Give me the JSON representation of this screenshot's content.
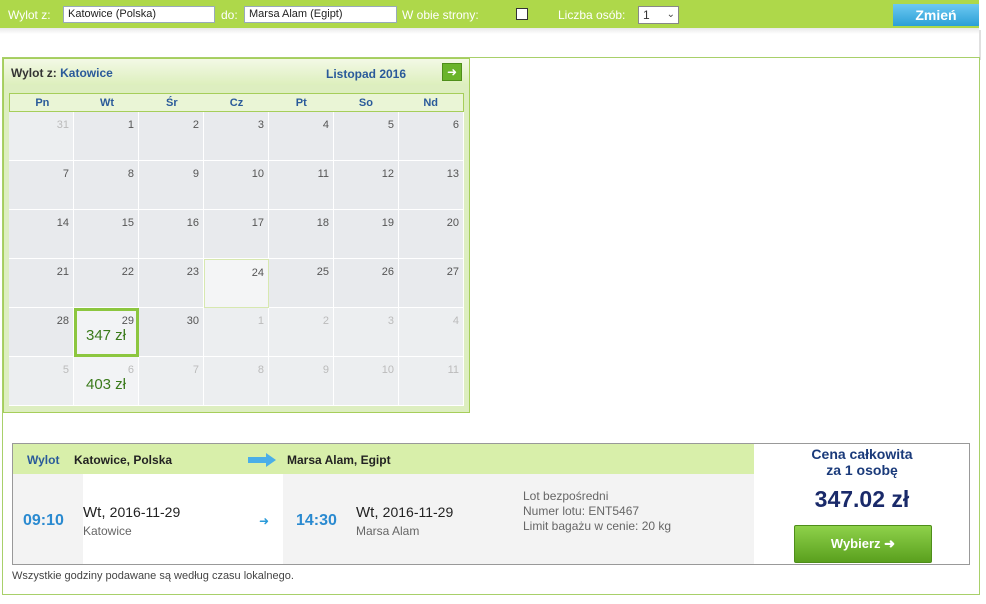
{
  "search": {
    "from_label": "Wylot z:",
    "from_value": "Katowice (Polska)",
    "to_label": "do:",
    "to_value": "Marsa Alam (Egipt)",
    "roundtrip_label": "W obie strony:",
    "passengers_label": "Liczba osób:",
    "passengers_value": "1",
    "change_button": "Zmień"
  },
  "calendar": {
    "from_prefix": "Wylot z:",
    "from_city": "Katowice",
    "month": "Listopad 2016",
    "weekdays": [
      "Pn",
      "Wt",
      "Śr",
      "Cz",
      "Pt",
      "So",
      "Nd"
    ],
    "days": [
      {
        "n": "31",
        "off": true
      },
      {
        "n": "1"
      },
      {
        "n": "2"
      },
      {
        "n": "3"
      },
      {
        "n": "4"
      },
      {
        "n": "5"
      },
      {
        "n": "6"
      },
      {
        "n": "7"
      },
      {
        "n": "8"
      },
      {
        "n": "9"
      },
      {
        "n": "10"
      },
      {
        "n": "11"
      },
      {
        "n": "12"
      },
      {
        "n": "13"
      },
      {
        "n": "14"
      },
      {
        "n": "15"
      },
      {
        "n": "16"
      },
      {
        "n": "17"
      },
      {
        "n": "18"
      },
      {
        "n": "19"
      },
      {
        "n": "20"
      },
      {
        "n": "21"
      },
      {
        "n": "22"
      },
      {
        "n": "23"
      },
      {
        "n": "24",
        "today": true
      },
      {
        "n": "25"
      },
      {
        "n": "26"
      },
      {
        "n": "27"
      },
      {
        "n": "28"
      },
      {
        "n": "29",
        "price": "347 zł",
        "selected": true
      },
      {
        "n": "30"
      },
      {
        "n": "1",
        "off": true
      },
      {
        "n": "2",
        "off": true
      },
      {
        "n": "3",
        "off": true
      },
      {
        "n": "4",
        "off": true
      },
      {
        "n": "5",
        "off": true
      },
      {
        "n": "6",
        "off": true,
        "price": "403 zł"
      },
      {
        "n": "7",
        "off": true
      },
      {
        "n": "8",
        "off": true
      },
      {
        "n": "9",
        "off": true
      },
      {
        "n": "10",
        "off": true
      },
      {
        "n": "11",
        "off": true
      }
    ]
  },
  "flight": {
    "header_label": "Wylot",
    "from_place": "Katowice, Polska",
    "to_place": "Marsa Alam, Egipt",
    "dep_time": "09:10",
    "dep_day": "Wt,",
    "dep_date": "2016-11-29",
    "dep_city": "Katowice",
    "arr_time": "14:30",
    "arr_day": "Wt,",
    "arr_date": "2016-11-29",
    "arr_city": "Marsa Alam",
    "detail_direct": "Lot bezpośredni",
    "detail_flight_no": "Numer lotu: ENT5467",
    "detail_baggage": "Limit bagażu w cenie: 20 kg",
    "price_header_1": "Cena całkowita",
    "price_header_2": "za 1 osobę",
    "price": "347.02 zł",
    "select_button": "Wybierz"
  },
  "note": "Wszystkie godziny podawane są według czasu lokalnego.",
  "colors": {
    "accent_green": "#aed84a",
    "button_blue": "#2b9fd6",
    "price_green": "#3a7a1a"
  }
}
